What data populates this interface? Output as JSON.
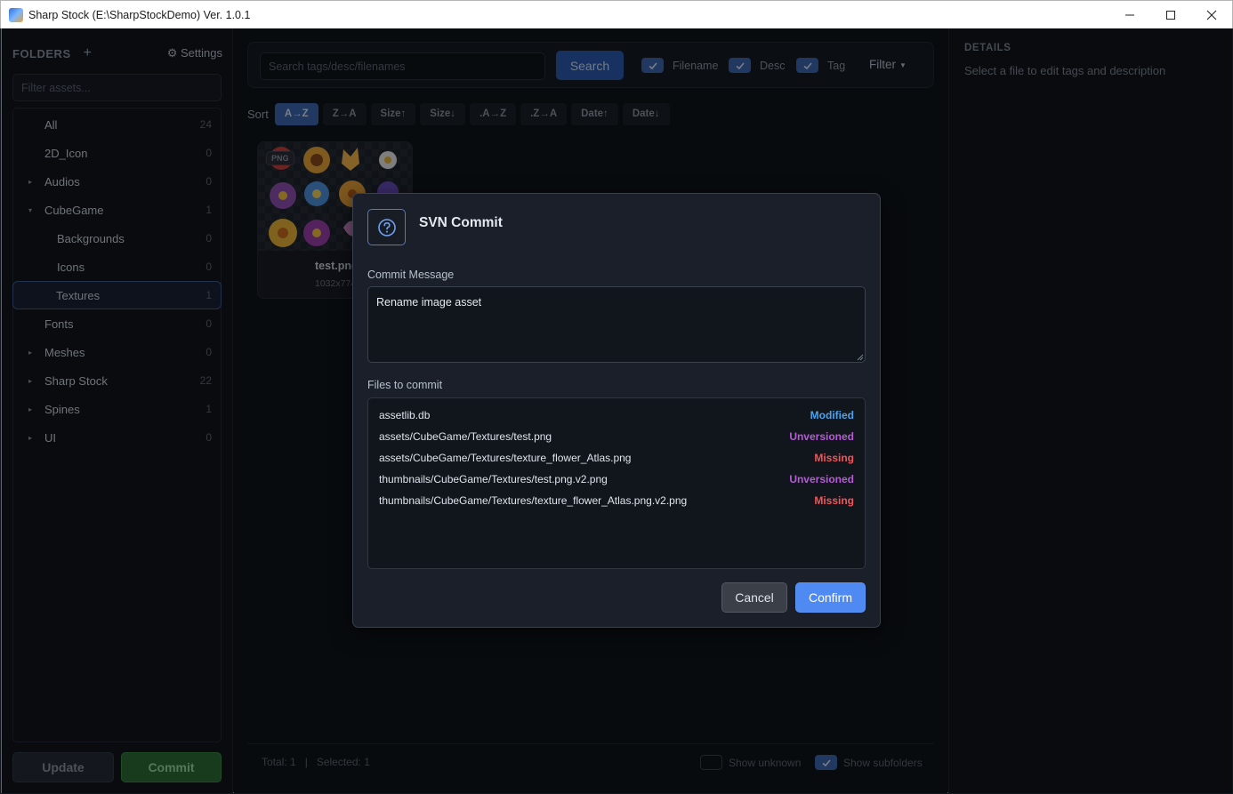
{
  "window": {
    "title": "Sharp Stock (E:\\SharpStockDemo) Ver. 1.0.1"
  },
  "sidebar": {
    "title": "FOLDERS",
    "add_label": "+",
    "settings_label": "⚙ Settings",
    "filter_placeholder": "Filter assets...",
    "items": [
      {
        "label": "All",
        "count": "24"
      },
      {
        "label": "2D_Icon",
        "count": "0"
      },
      {
        "label": "Audios",
        "count": "0"
      },
      {
        "label": "CubeGame",
        "count": "1"
      },
      {
        "label": "Backgrounds",
        "count": "0"
      },
      {
        "label": "Icons",
        "count": "0"
      },
      {
        "label": "Textures",
        "count": "1"
      },
      {
        "label": "Fonts",
        "count": "0"
      },
      {
        "label": "Meshes",
        "count": "0"
      },
      {
        "label": "Sharp Stock",
        "count": "22"
      },
      {
        "label": "Spines",
        "count": "1"
      },
      {
        "label": "UI",
        "count": "0"
      }
    ],
    "update_label": "Update",
    "commit_label": "Commit"
  },
  "search": {
    "placeholder": "Search tags/desc/filenames",
    "button_label": "Search",
    "filename_label": "Filename",
    "desc_label": "Desc",
    "tag_label": "Tag",
    "filter_label": "Filter"
  },
  "sort": {
    "label": "Sort",
    "options": [
      "A→Z",
      "Z→A",
      "Size↑",
      "Size↓",
      ".A→Z",
      ".Z→A",
      "Date↑",
      "Date↓"
    ]
  },
  "card": {
    "badge": "PNG",
    "name": "test.png",
    "size": "1032x774"
  },
  "status": {
    "total": "Total: 1",
    "separator": "|",
    "selected": "Selected: 1",
    "show_unknown": "Show unknown",
    "show_subfolders": "Show subfolders"
  },
  "details": {
    "title": "DETAILS",
    "subtitle": "Select a file to edit tags and description"
  },
  "dialog": {
    "title": "SVN Commit",
    "message_label": "Commit Message",
    "message_value": "Rename image asset",
    "files_label": "Files to commit",
    "files": [
      {
        "path": "assetlib.db",
        "status": "Modified"
      },
      {
        "path": "assets/CubeGame/Textures/test.png",
        "status": "Unversioned"
      },
      {
        "path": "assets/CubeGame/Textures/texture_flower_Atlas.png",
        "status": "Missing"
      },
      {
        "path": "thumbnails/CubeGame/Textures/test.png.v2.png",
        "status": "Unversioned"
      },
      {
        "path": "thumbnails/CubeGame/Textures/texture_flower_Atlas.png.v2.png",
        "status": "Missing"
      }
    ],
    "cancel_label": "Cancel",
    "confirm_label": "Confirm"
  },
  "colors": {
    "accent": "#4f8af2",
    "modified": "#4aa3f0",
    "unversioned": "#b65ad6",
    "missing": "#f0555a",
    "commit_green": "#2c6b35"
  }
}
